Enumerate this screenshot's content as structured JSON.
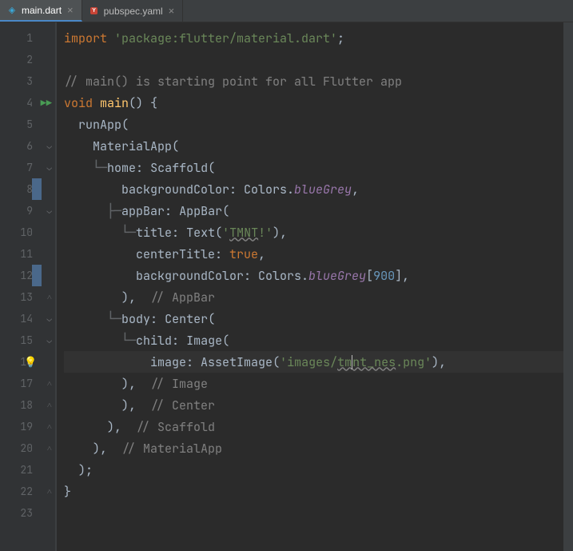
{
  "tabs": [
    {
      "label": "main.dart",
      "icon": "dart",
      "active": true
    },
    {
      "label": "pubspec.yaml",
      "icon": "yaml",
      "active": false
    }
  ],
  "lines": {
    "1": {
      "num": "1",
      "tokens": [
        [
          "kw",
          "import"
        ],
        [
          "pn",
          " "
        ],
        [
          "str",
          "'package:flutter/material.dart'"
        ],
        [
          "pn",
          ";"
        ]
      ]
    },
    "2": {
      "num": "2",
      "tokens": []
    },
    "3": {
      "num": "3",
      "tokens": [
        [
          "cmt",
          "// main() is starting point for all Flutter app"
        ]
      ]
    },
    "4": {
      "num": "4",
      "run": true,
      "fold": "down",
      "tokens": [
        [
          "kw",
          "void"
        ],
        [
          "pn",
          " "
        ],
        [
          "fn",
          "main"
        ],
        [
          "pn",
          "() {"
        ]
      ]
    },
    "5": {
      "num": "5",
      "tokens": [
        [
          "pn",
          "  "
        ],
        [
          "cls",
          "runApp"
        ],
        [
          "pn",
          "("
        ]
      ]
    },
    "6": {
      "num": "6",
      "fold": "down",
      "tokens": [
        [
          "pn",
          "    "
        ],
        [
          "cls",
          "MaterialApp"
        ],
        [
          "pn",
          "("
        ]
      ]
    },
    "7": {
      "num": "7",
      "fold": "down",
      "tokens": [
        [
          "pn",
          "    "
        ],
        [
          "tree-v",
          "└─"
        ],
        [
          "cls",
          "home"
        ],
        [
          "pn",
          ": "
        ],
        [
          "cls",
          "Scaffold"
        ],
        [
          "pn",
          "("
        ]
      ]
    },
    "8": {
      "num": "8",
      "change": true,
      "tokens": [
        [
          "pn",
          "        "
        ],
        [
          "cls",
          "backgroundColor"
        ],
        [
          "pn",
          ": Colors."
        ],
        [
          "stat",
          "blueGrey"
        ],
        [
          "pn",
          ","
        ]
      ]
    },
    "9": {
      "num": "9",
      "fold": "down",
      "tokens": [
        [
          "pn",
          "      "
        ],
        [
          "tree-v",
          "├─"
        ],
        [
          "cls",
          "appBar"
        ],
        [
          "pn",
          ": "
        ],
        [
          "cls",
          "AppBar"
        ],
        [
          "pn",
          "("
        ]
      ]
    },
    "10": {
      "num": "10",
      "tokens": [
        [
          "pn",
          "        "
        ],
        [
          "tree-v",
          "└─"
        ],
        [
          "cls",
          "title"
        ],
        [
          "pn",
          ": "
        ],
        [
          "cls",
          "Text"
        ],
        [
          "pn",
          "("
        ],
        [
          "str",
          "'"
        ],
        [
          "str-u",
          "TMNT"
        ],
        [
          "str",
          "!'"
        ],
        [
          "pn",
          "),"
        ]
      ]
    },
    "11": {
      "num": "11",
      "tokens": [
        [
          "pn",
          "          "
        ],
        [
          "cls",
          "centerTitle"
        ],
        [
          "pn",
          ": "
        ],
        [
          "const",
          "true"
        ],
        [
          "pn",
          ","
        ]
      ]
    },
    "12": {
      "num": "12",
      "change": true,
      "tokens": [
        [
          "pn",
          "          "
        ],
        [
          "cls",
          "backgroundColor"
        ],
        [
          "pn",
          ": Colors."
        ],
        [
          "stat",
          "blueGrey"
        ],
        [
          "pn",
          "["
        ],
        [
          "num",
          "900"
        ],
        [
          "pn",
          "],"
        ]
      ]
    },
    "13": {
      "num": "13",
      "fold": "up",
      "tokens": [
        [
          "pn",
          "        ),  "
        ],
        [
          "cmt",
          "// AppBar"
        ]
      ]
    },
    "14": {
      "num": "14",
      "fold": "down",
      "tokens": [
        [
          "pn",
          "      "
        ],
        [
          "tree-v",
          "└─"
        ],
        [
          "cls",
          "body"
        ],
        [
          "pn",
          ": "
        ],
        [
          "cls",
          "Center"
        ],
        [
          "pn",
          "("
        ]
      ]
    },
    "15": {
      "num": "15",
      "fold": "down",
      "tokens": [
        [
          "pn",
          "        "
        ],
        [
          "tree-v",
          "└─"
        ],
        [
          "cls",
          "child"
        ],
        [
          "pn",
          ": "
        ],
        [
          "cls",
          "Image"
        ],
        [
          "pn",
          "("
        ]
      ]
    },
    "16": {
      "num": "16",
      "bulb": true,
      "current": true,
      "tokens": [
        [
          "pn",
          "            "
        ],
        [
          "cls",
          "image"
        ],
        [
          "pn",
          ": "
        ],
        [
          "cls",
          "AssetImage"
        ],
        [
          "pn",
          "("
        ],
        [
          "str",
          "'images/"
        ],
        [
          "str-u",
          "tm"
        ],
        [
          "caret",
          ""
        ],
        [
          "str-u",
          "nt_nes"
        ],
        [
          "str",
          ".png'"
        ],
        [
          "pn",
          "),"
        ]
      ]
    },
    "17": {
      "num": "17",
      "fold": "up",
      "tokens": [
        [
          "pn",
          "        ),  "
        ],
        [
          "cmt",
          "// Image"
        ]
      ]
    },
    "18": {
      "num": "18",
      "fold": "up",
      "tokens": [
        [
          "pn",
          "        ),  "
        ],
        [
          "cmt",
          "// Center"
        ]
      ]
    },
    "19": {
      "num": "19",
      "fold": "up",
      "tokens": [
        [
          "pn",
          "      ),  "
        ],
        [
          "cmt",
          "// Scaffold"
        ]
      ]
    },
    "20": {
      "num": "20",
      "fold": "up",
      "tokens": [
        [
          "pn",
          "    ),  "
        ],
        [
          "cmt",
          "// MaterialApp"
        ]
      ]
    },
    "21": {
      "num": "21",
      "tokens": [
        [
          "pn",
          "  );"
        ]
      ]
    },
    "22": {
      "num": "22",
      "fold": "up",
      "tokens": [
        [
          "pn",
          "}"
        ]
      ]
    },
    "23": {
      "num": "23",
      "tokens": []
    }
  },
  "chart_data": null
}
